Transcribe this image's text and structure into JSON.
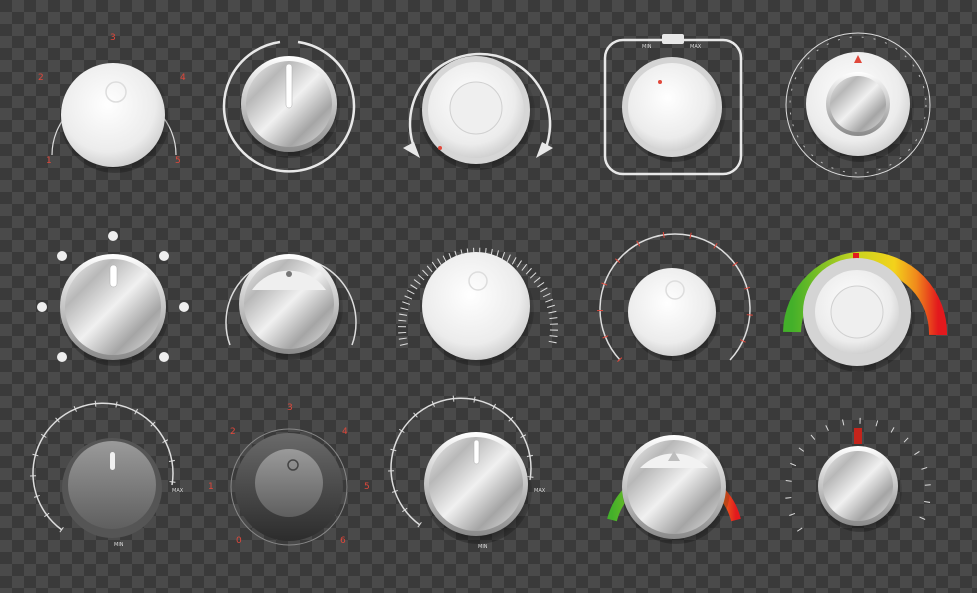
{
  "knob_set": {
    "row1": {
      "k1_labels": [
        "1",
        "2",
        "3",
        "4",
        "5"
      ],
      "k4_labels": [
        "MIN",
        "MAX"
      ]
    },
    "row3": {
      "k1_labels": [
        "MAX",
        "MIN"
      ],
      "k2_labels": [
        "0",
        "1",
        "2",
        "3",
        "4",
        "5",
        "6",
        "7",
        "8"
      ],
      "k3_labels": [
        "MAX",
        "MIN"
      ]
    }
  },
  "colors": {
    "background_dark": "#3a3a3a",
    "background_light": "#4a4a4a",
    "accent_red": "#e0483b",
    "gauge_green": "#43b02a",
    "gauge_yellow": "#f3d21b",
    "gauge_red": "#e3191d",
    "white_knob": "#f2f2f2",
    "metal_light": "#e6e6e6",
    "metal_dark": "#8d8d8d"
  }
}
